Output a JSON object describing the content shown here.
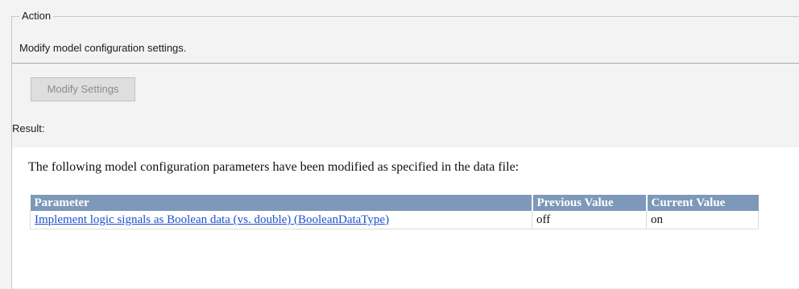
{
  "action_group": {
    "title": "Action",
    "description": "Modify model configuration settings.",
    "button_label": "Modify Settings"
  },
  "result": {
    "label": "Result:",
    "message": "The following model configuration parameters have been modified as specified in the data file:",
    "table": {
      "headers": [
        "Parameter",
        "Previous Value",
        "Current Value"
      ],
      "rows": [
        {
          "parameter": "Implement logic signals as Boolean data (vs. double) (BooleanDataType)",
          "previous": "off",
          "current": "on"
        }
      ]
    }
  },
  "colors": {
    "header_bg": "#7d98b8",
    "link": "#1f4fd0",
    "panel_bg": "#f3f3f3"
  }
}
